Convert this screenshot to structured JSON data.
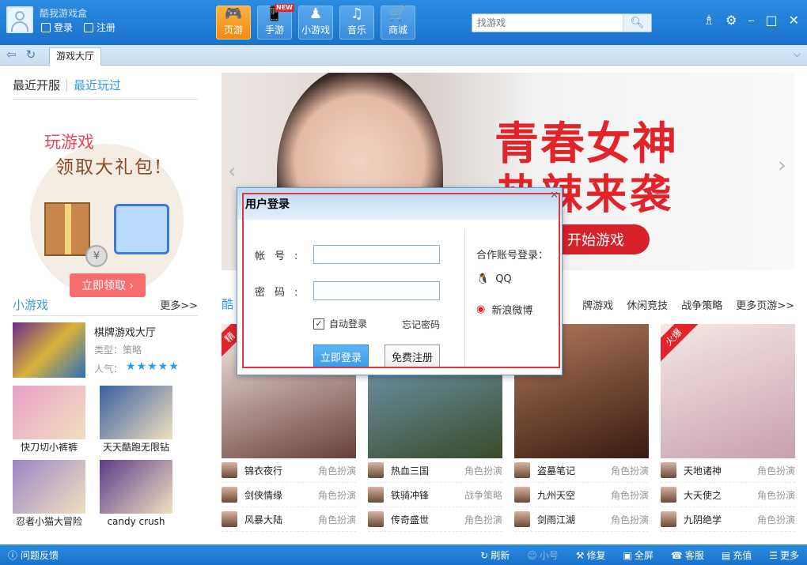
{
  "app": {
    "title": "酷我游戏盒",
    "login": "登录",
    "register": "注册"
  },
  "nav": [
    {
      "label": "页游",
      "glyph": "🎮",
      "active": true
    },
    {
      "label": "手游",
      "glyph": "📱",
      "badge": "NEW"
    },
    {
      "label": "小游戏",
      "glyph": "♟"
    },
    {
      "label": "音乐",
      "glyph": "♫"
    },
    {
      "label": "商城",
      "glyph": "🛒"
    }
  ],
  "search": {
    "placeholder": "找游戏"
  },
  "tabbar": {
    "tab": "游戏大厅"
  },
  "left": {
    "tab_recent_open": "最近开服",
    "tab_recent_played": "最近玩过",
    "promo": {
      "line1": "玩游戏",
      "line2": "领取大礼包!",
      "coin": "¥",
      "button": "立即领取 ›"
    },
    "small_games": {
      "title": "小游戏",
      "more": "更多>>"
    },
    "featured": {
      "name": "棋牌游戏大厅",
      "type": "类型：策略",
      "popularity": "人气：",
      "stars": "★★★★★"
    },
    "games": [
      {
        "label": "快刀切小裤裤",
        "color": "#e9a0c8"
      },
      {
        "label": "天天酷跑无限钻",
        "color": "#3b5fa0"
      },
      {
        "label": "忍者小猫大冒险",
        "color": "#9b86c6"
      },
      {
        "label": "candy crush",
        "color": "#5a3d8a"
      }
    ]
  },
  "banner": {
    "headline1": "青春女神",
    "headline2": "热辣来袭",
    "button": "开始游戏"
  },
  "categories": {
    "first": "酷",
    "items": [
      "牌游戏",
      "休闲竞技",
      "战争策略",
      "更多页游>>"
    ]
  },
  "columns": [
    {
      "ribbon": "精",
      "poster": [
        "#f4ece8",
        "#6a3f3a"
      ],
      "rows": [
        {
          "name": "锦衣夜行",
          "type": "角色扮演"
        },
        {
          "name": "剑侠情缘",
          "type": "角色扮演"
        },
        {
          "name": "风暴大陆",
          "type": "角色扮演"
        }
      ]
    },
    {
      "ribbon": "",
      "poster": [
        "#7aa6c8",
        "#3a4a2a"
      ],
      "rows": [
        {
          "name": "热血三国",
          "type": "角色扮演"
        },
        {
          "name": "铁骑冲锋",
          "type": "战争策略"
        },
        {
          "name": "传奇盛世",
          "type": "角色扮演"
        }
      ]
    },
    {
      "ribbon": "",
      "poster": [
        "#b07a5a",
        "#3a1a12"
      ],
      "rows": [
        {
          "name": "盗墓笔记",
          "type": "角色扮演"
        },
        {
          "name": "九州天空",
          "type": "角色扮演"
        },
        {
          "name": "剑雨江湖",
          "type": "角色扮演"
        }
      ]
    },
    {
      "ribbon": "火爆",
      "poster": [
        "#f5e8e4",
        "#c8a0b0"
      ],
      "rows": [
        {
          "name": "天地诸神",
          "type": "角色扮演"
        },
        {
          "name": "大天使之",
          "type": "角色扮演"
        },
        {
          "name": "九阴绝学",
          "type": "角色扮演"
        }
      ]
    }
  ],
  "footer": {
    "feedback": "问题反馈",
    "refresh": "刷新",
    "small": "小号",
    "repair": "修复",
    "fullscreen": "全屏",
    "service": "客服",
    "recharge": "充值",
    "more": "更多"
  },
  "dialog": {
    "title": "用户登录",
    "account_label": "帐号:",
    "password_label": "密码:",
    "auto_login": "自动登录",
    "forgot": "忘记密码",
    "login_btn": "立即登录",
    "register_btn": "免费注册",
    "partner": "合作账号登录：",
    "qq": "QQ",
    "weibo": "新浪微博"
  }
}
